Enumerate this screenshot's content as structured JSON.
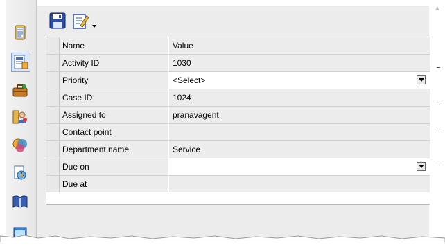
{
  "toolbar": {
    "save_icon": "floppy-disk-save-icon",
    "edit_icon": "edit-document-icon",
    "dropdown_icon": "chevron-down-icon"
  },
  "sidebar": {
    "icons": [
      "document-list-icon",
      "activity-form-icon",
      "briefcase-icon",
      "people-directory-icon",
      "team-icon",
      "report-clock-icon",
      "book-icon",
      "window-icon"
    ]
  },
  "grid": {
    "header": {
      "name": "Name",
      "value": "Value"
    },
    "rows": [
      {
        "name": "Activity ID",
        "value": "1030"
      },
      {
        "name": "Priority",
        "value": "<Select>"
      },
      {
        "name": "Case ID",
        "value": "1024"
      },
      {
        "name": "Assigned to",
        "value": "pranavagent"
      },
      {
        "name": "Contact point",
        "value": ""
      },
      {
        "name": "Department name",
        "value": "Service"
      },
      {
        "name": "Due on",
        "value": ""
      },
      {
        "name": "Due at",
        "value": ""
      }
    ]
  },
  "colors": {
    "panel_bg": "#ececec",
    "grid_line": "#d0d0d0",
    "save_blue": "#2a4fa8"
  }
}
